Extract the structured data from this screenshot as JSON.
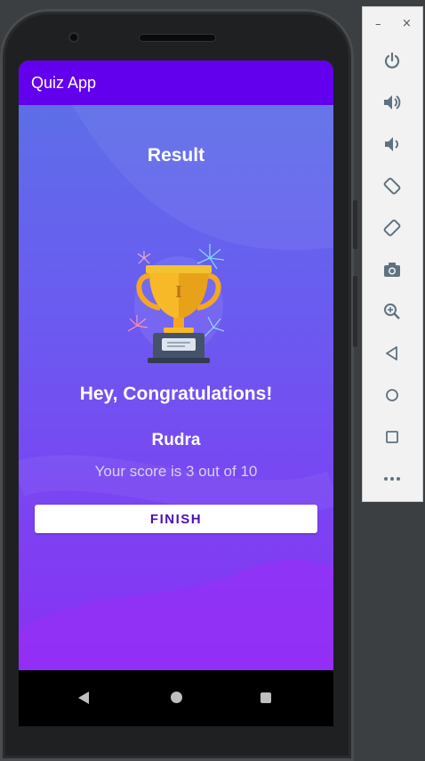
{
  "app": {
    "title": "Quiz App"
  },
  "result": {
    "heading": "Result",
    "congrats": "Hey, Congratulations!",
    "name": "Rudra",
    "score_text": "Your score is 3 out of 10",
    "finish_label": "FINISH"
  },
  "colors": {
    "appbar": "#6200ee",
    "accent_text": "#4a10b8"
  },
  "navigation": {
    "icons": [
      "back-icon",
      "home-icon",
      "recents-icon"
    ]
  },
  "emulator_toolbar": {
    "window_controls": [
      "minimize-icon",
      "close-icon"
    ],
    "icons": [
      "power-icon",
      "volume-up-icon",
      "volume-down-icon",
      "rotate-left-icon",
      "rotate-right-icon",
      "camera-icon",
      "zoom-icon",
      "back-icon",
      "home-icon",
      "overview-icon",
      "more-icon"
    ],
    "minimize_glyph": "–",
    "close_glyph": "×"
  }
}
